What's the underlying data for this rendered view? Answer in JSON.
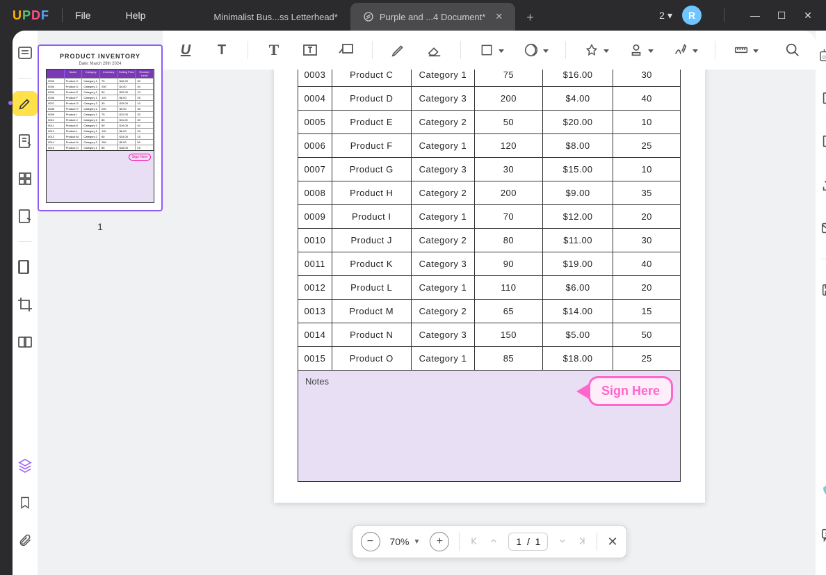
{
  "app": {
    "name": "UPDF"
  },
  "menu": {
    "file": "File",
    "help": "Help"
  },
  "tabs": {
    "items": [
      {
        "label": "Minimalist Bus...ss Letterhead*"
      },
      {
        "label": "Purple and ...4 Document*"
      }
    ],
    "activeIndex": 1
  },
  "user": {
    "count": "2",
    "initial": "R"
  },
  "thumbnail": {
    "title": "PRODUCT INVENTORY",
    "date": "Date: March 29th 2024",
    "page_label": "1",
    "headers": [
      "",
      "Name",
      "Category",
      "Inventory",
      "Selling Price",
      "Reorder Level"
    ],
    "sign": "Sign Here"
  },
  "document": {
    "rows": [
      {
        "id": "0003",
        "name": "Product C",
        "cat": "Category 1",
        "inv": "75",
        "price": "$16.00",
        "reorder": "30"
      },
      {
        "id": "0004",
        "name": "Product D",
        "cat": "Category 3",
        "inv": "200",
        "price": "$4.00",
        "reorder": "40"
      },
      {
        "id": "0005",
        "name": "Product E",
        "cat": "Category 2",
        "inv": "50",
        "price": "$20.00",
        "reorder": "10"
      },
      {
        "id": "0006",
        "name": "Product F",
        "cat": "Category 1",
        "inv": "120",
        "price": "$8.00",
        "reorder": "25"
      },
      {
        "id": "0007",
        "name": "Product G",
        "cat": "Category 3",
        "inv": "30",
        "price": "$15.00",
        "reorder": "10"
      },
      {
        "id": "0008",
        "name": "Product H",
        "cat": "Category 2",
        "inv": "200",
        "price": "$9.00",
        "reorder": "35"
      },
      {
        "id": "0009",
        "name": "Product I",
        "cat": "Category 1",
        "inv": "70",
        "price": "$12.00",
        "reorder": "20"
      },
      {
        "id": "0010",
        "name": "Product J",
        "cat": "Category 2",
        "inv": "80",
        "price": "$11.00",
        "reorder": "30"
      },
      {
        "id": "0011",
        "name": "Product K",
        "cat": "Category 3",
        "inv": "90",
        "price": "$19.00",
        "reorder": "40"
      },
      {
        "id": "0012",
        "name": "Product L",
        "cat": "Category 1",
        "inv": "110",
        "price": "$6.00",
        "reorder": "20"
      },
      {
        "id": "0013",
        "name": "Product M",
        "cat": "Category 2",
        "inv": "65",
        "price": "$14.00",
        "reorder": "15"
      },
      {
        "id": "0014",
        "name": "Product N",
        "cat": "Category 3",
        "inv": "150",
        "price": "$5.00",
        "reorder": "50"
      },
      {
        "id": "0015",
        "name": "Product O",
        "cat": "Category 1",
        "inv": "85",
        "price": "$18.00",
        "reorder": "25"
      }
    ],
    "notes_label": "Notes",
    "sign_here": "Sign Here"
  },
  "page_controls": {
    "zoom": "70%",
    "current_page": "1",
    "separator": "/",
    "total_pages": "1"
  },
  "icons": {
    "underline": "U",
    "text_style": "T",
    "text_big": "T",
    "minus": "−",
    "plus": "+",
    "divider": "/",
    "close": "✕",
    "chevron_down": "▾"
  }
}
